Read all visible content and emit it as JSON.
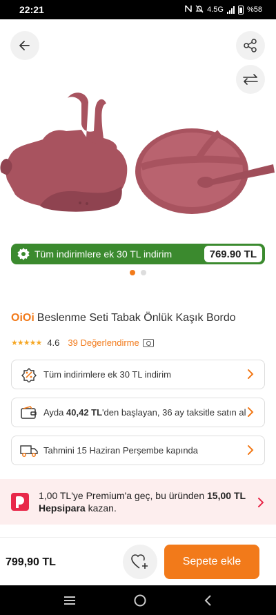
{
  "status_bar": {
    "time": "22:21",
    "network": "4.5G",
    "battery": "%58"
  },
  "promo_banner": {
    "text": "Tüm indirimlere ek 30 TL indirim",
    "price": "769.90 TL"
  },
  "carousel": {
    "total": 2,
    "active": 0
  },
  "product": {
    "brand": "OiOi",
    "name": "Beslenme Seti Tabak Önlük Kaşık Bordo",
    "rating": "4.6",
    "rating_stars": 4.6,
    "reviews": "39 Değerlendirme"
  },
  "cards": {
    "discount": "Tüm indirimlere ek 30 TL indirim",
    "installment_prefix": "Ayda ",
    "installment_amount": "40,42 TL",
    "installment_suffix": "'den başlayan, 36 ay taksitle satın al",
    "delivery": "Tahmini 15 Haziran Perşembe kapında"
  },
  "premium": {
    "line_a": "1,00 TL'ye Premium'a geç, bu üründen ",
    "amount": "15,00 TL Hepsipara",
    "line_b": " kazan."
  },
  "bottom_bar": {
    "price": "799,90 TL",
    "cart_label": "Sepete ekle"
  },
  "colors": {
    "accent": "#f27a1a",
    "promo_green": "#3b8a2e",
    "product": "#a8535f",
    "premium_bg": "#fdeeee"
  }
}
